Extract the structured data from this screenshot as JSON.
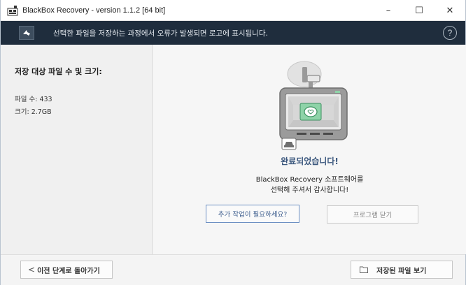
{
  "window": {
    "title": "BlackBox Recovery - version 1.1.2 [64 bit]",
    "controls": {
      "minimize": "–",
      "maximize": "☐",
      "close": "✕"
    }
  },
  "header": {
    "message": "선택한 파일을 저장하는 과정에서 오류가 발생되면 로고에 표시됩니다.",
    "help": "?"
  },
  "summary": {
    "title": "저장 대상 파일 수 및 크기:",
    "file_count_label": "파일 수: 433",
    "size_label": "크기: 2.7GB"
  },
  "result": {
    "title": "완료되었습니다!",
    "thanks_line1": "BlackBox Recovery 소프트웨어를",
    "thanks_line2": "선택해 주셔서 감사합니다!"
  },
  "actions": {
    "more_work": "추가 작업이 필요하세요?",
    "close_program": "프로그램 닫기"
  },
  "footer": {
    "prev_step": "이전 단계로 돌아가기",
    "view_saved": "저장된 파일 보기"
  },
  "icons": {
    "app": "app-icon",
    "back": "back-arrow-icon",
    "help": "help-icon",
    "illustration": "dashcam-icon",
    "folder": "folder-icon"
  },
  "colors": {
    "header_bg": "#1f2d3d",
    "accent": "#3c587e",
    "screen_green": "#8ed3a8"
  }
}
